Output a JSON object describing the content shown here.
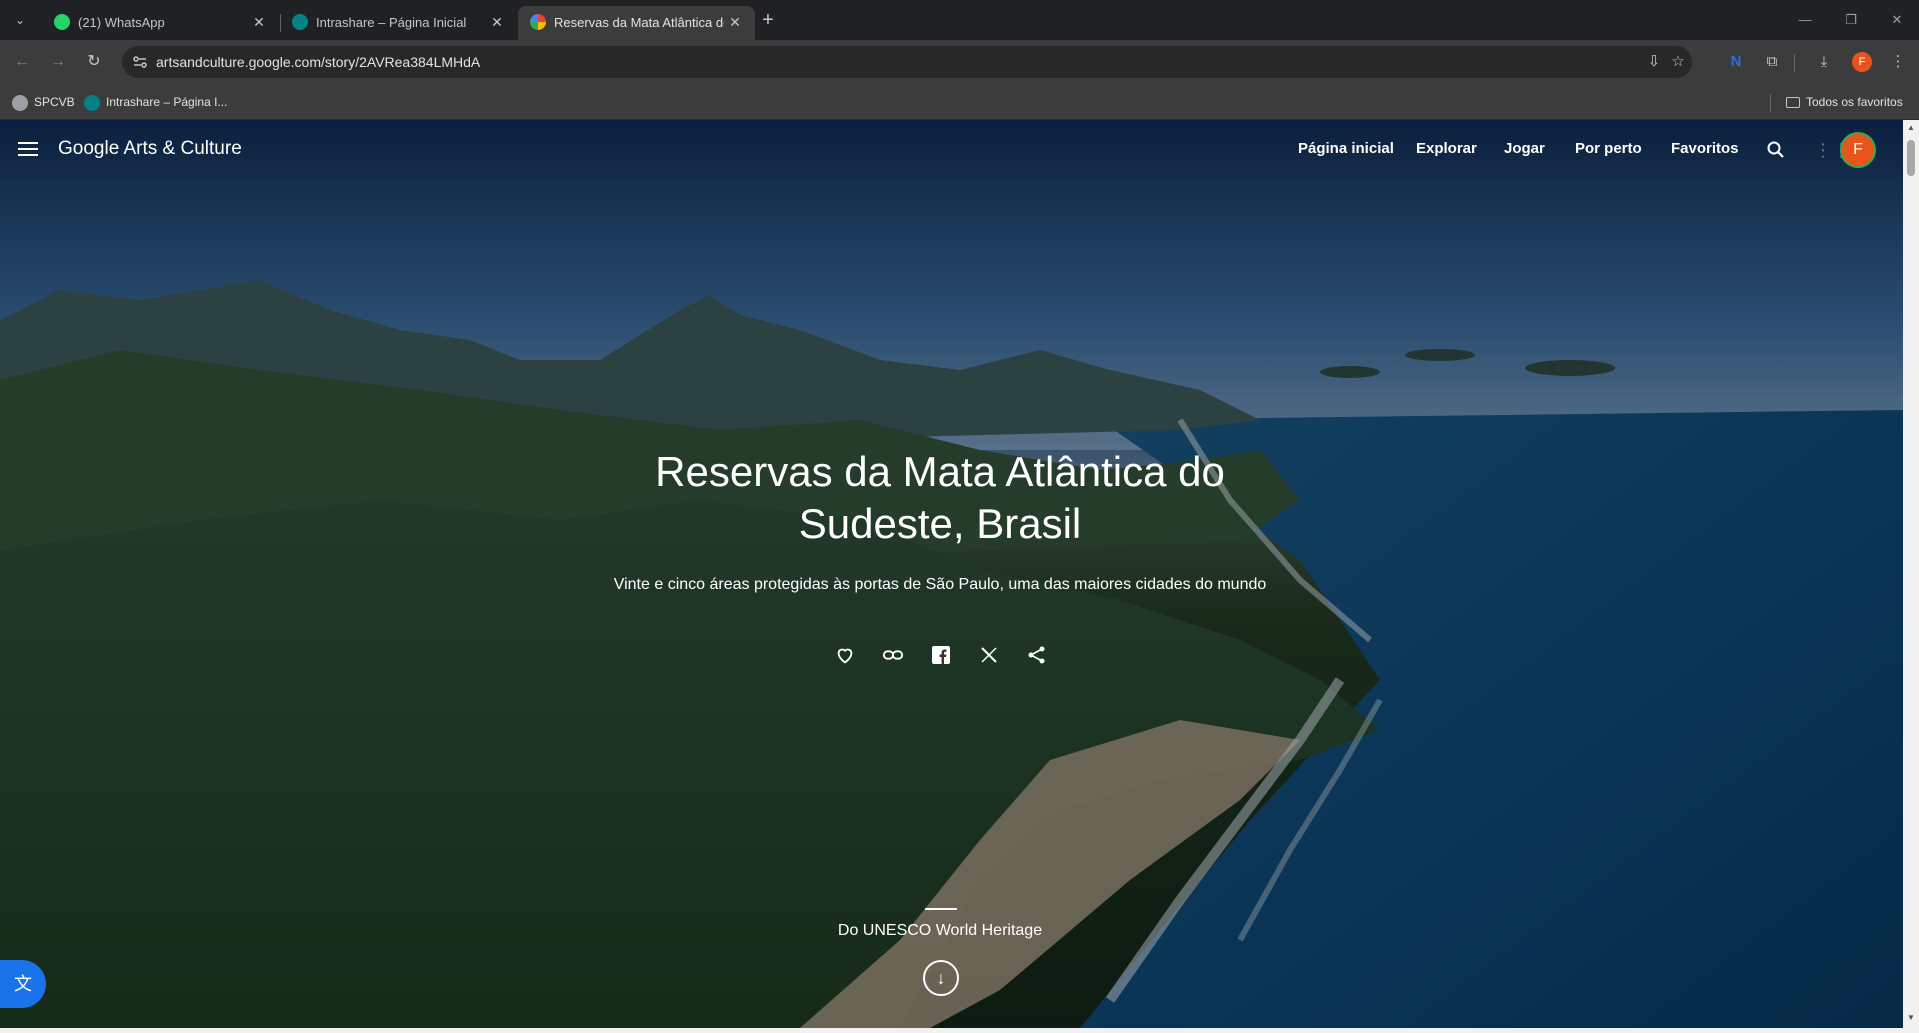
{
  "browser": {
    "tabs": [
      {
        "title": "(21) WhatsApp",
        "icon": "whatsapp-icon",
        "color": "#25d366"
      },
      {
        "title": "Intrashare – Página Inicial",
        "icon": "sharepoint-icon",
        "color": "#038387"
      },
      {
        "title": "Reservas da Mata Atlântica do S",
        "icon": "google-arts-icon",
        "color": "#ea4335",
        "active": true
      }
    ],
    "url": "artsandculture.google.com/story/2AVRea384LMHdA",
    "profile_initial": "F",
    "bookmarks": [
      {
        "label": "SPCVB",
        "icon": "globe-icon"
      },
      {
        "label": "Intrashare – Página I...",
        "icon": "sharepoint-icon"
      }
    ],
    "all_bookmarks_label": "Todos os favoritos"
  },
  "site": {
    "logo": "Google Arts & Culture",
    "nav": [
      "Página inicial",
      "Explorar",
      "Jogar",
      "Por perto",
      "Favoritos"
    ],
    "avatar_initial": "F",
    "accent": "#e8541e"
  },
  "hero": {
    "title_line1": "Reservas da Mata Atlântica do",
    "title_line2": "Sudeste, Brasil",
    "subtitle": "Vinte e cinco áreas protegidas às portas de São Paulo, uma das maiores cidades do mundo",
    "from": "Do UNESCO World Heritage"
  }
}
